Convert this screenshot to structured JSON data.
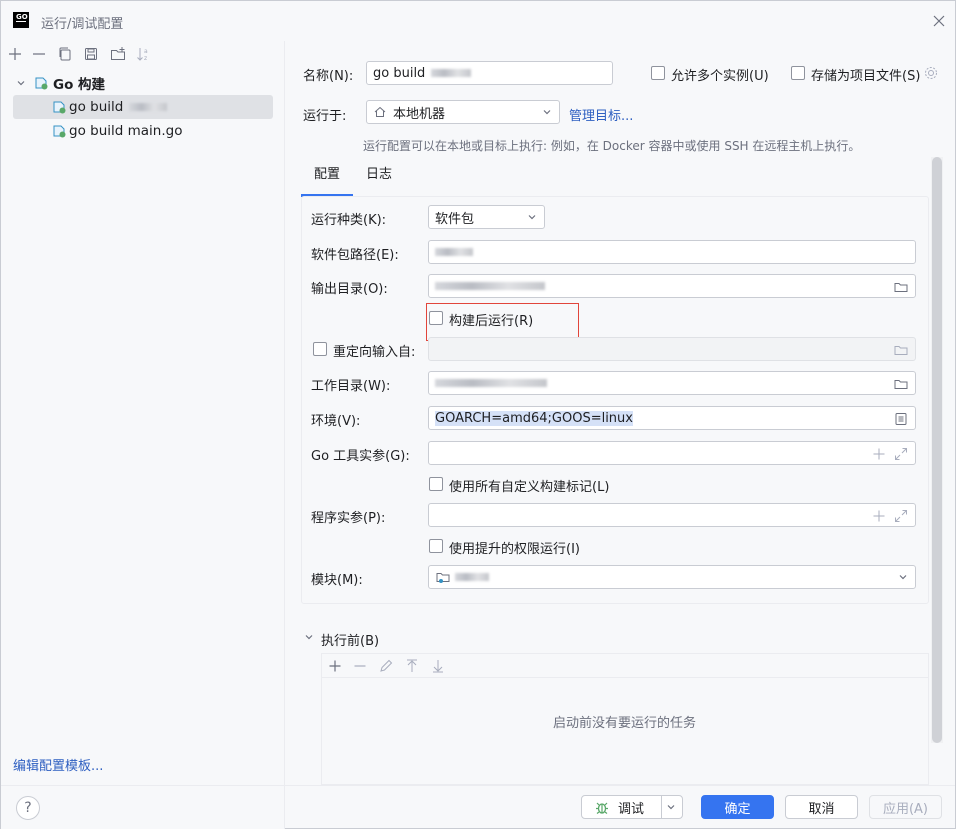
{
  "window": {
    "title": "运行/调试配置",
    "logo_text": "GO"
  },
  "left": {
    "tree": [
      {
        "label": "Go 构建",
        "expanded": true
      },
      {
        "label": "go build",
        "selected": true
      },
      {
        "label": "go build main.go"
      }
    ],
    "edit_templates": "编辑配置模板..."
  },
  "header": {
    "name_label": "名称(N):",
    "name_value": "go build",
    "allow_multiple": "允许多个实例(U)",
    "store_as_file": "存储为项目文件(S)",
    "run_on_label": "运行于:",
    "run_on_value": "本地机器",
    "manage_targets": "管理目标...",
    "hint": "运行配置可以在本地或目标上执行: 例如，在 Docker 容器中或使用 SSH 在远程主机上执行。"
  },
  "tabs": [
    {
      "label": "配置",
      "active": true
    },
    {
      "label": "日志"
    }
  ],
  "config": {
    "run_kind_label": "运行种类(K):",
    "run_kind_value": "软件包",
    "package_path_label": "软件包路径(E):",
    "output_dir_label": "输出目录(O):",
    "run_after_build": "构建后运行(R)",
    "redirect_input": "重定向输入自:",
    "working_dir_label": "工作目录(W):",
    "env_label": "环境(V):",
    "env_value": "GOARCH=amd64;GOOS=linux",
    "go_tool_args_label": "Go 工具实参(G):",
    "use_custom_tags": "使用所有自定义构建标记(L)",
    "program_args_label": "程序实参(P):",
    "elevated": "使用提升的权限运行(I)",
    "module_label": "模块(M):"
  },
  "before_launch": {
    "title": "执行前(B)",
    "empty": "启动前没有要运行的任务"
  },
  "footer": {
    "debug": "调试",
    "ok": "确定",
    "cancel": "取消",
    "apply": "应用(A)",
    "help": "?"
  },
  "colors": {
    "accent": "#3574f0",
    "link": "#2e5fc1",
    "highlight": "#e1453b"
  }
}
